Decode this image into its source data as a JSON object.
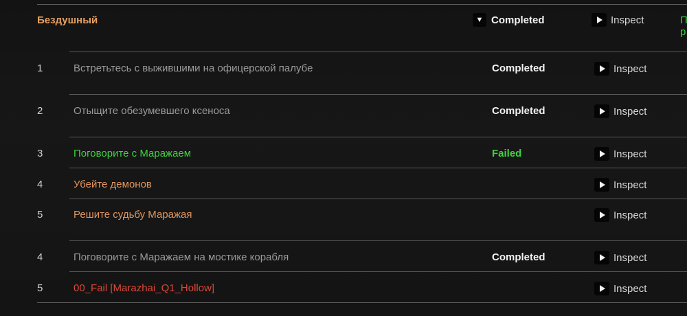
{
  "quest": {
    "title": "Бездушный",
    "status_label": "Completed",
    "dropdown_glyph": "▼",
    "inspect_label": "Inspect",
    "right_text_line1": "П",
    "right_text_line2": "р"
  },
  "objectives": [
    {
      "num": "1",
      "text": "Встретьтесь с выжившими на офицерской палубе",
      "status": "Completed",
      "inspect": "Inspect",
      "text_color": "gray"
    },
    {
      "num": "2",
      "text": "Отыщите обезумевшего ксеноса",
      "status": "Completed",
      "inspect": "Inspect",
      "text_color": "gray"
    },
    {
      "num": "3",
      "text": "Поговорите с Маражаем",
      "status": "Failed",
      "inspect": "Inspect",
      "text_color": "green"
    },
    {
      "num": "4",
      "text": "Убейте демонов",
      "status": "",
      "inspect": "Inspect",
      "text_color": "orange"
    },
    {
      "num": "5",
      "text": "Решите судьбу Маражая",
      "status": "",
      "inspect": "Inspect",
      "text_color": "orange"
    },
    {
      "num": "4",
      "text": "Поговорите с Маражаем на мостике корабля",
      "status": "Completed",
      "inspect": "Inspect",
      "text_color": "gray"
    },
    {
      "num": "5",
      "text": "00_Fail [Marazhai_Q1_Hollow]",
      "status": "",
      "inspect": "Inspect",
      "text_color": "red"
    }
  ],
  "colors": {
    "background": "#151515",
    "title_orange": "#e8a060",
    "completed_white": "#f2f2f2",
    "failed_green": "#3fd23f",
    "objective_gray": "#9a9a9a",
    "objective_orange": "#e0965e",
    "objective_red": "#d8483a",
    "divider": "#5a5a5a"
  },
  "icons": {
    "dropdown": "chevron-down-icon",
    "inspect": "play-icon"
  }
}
